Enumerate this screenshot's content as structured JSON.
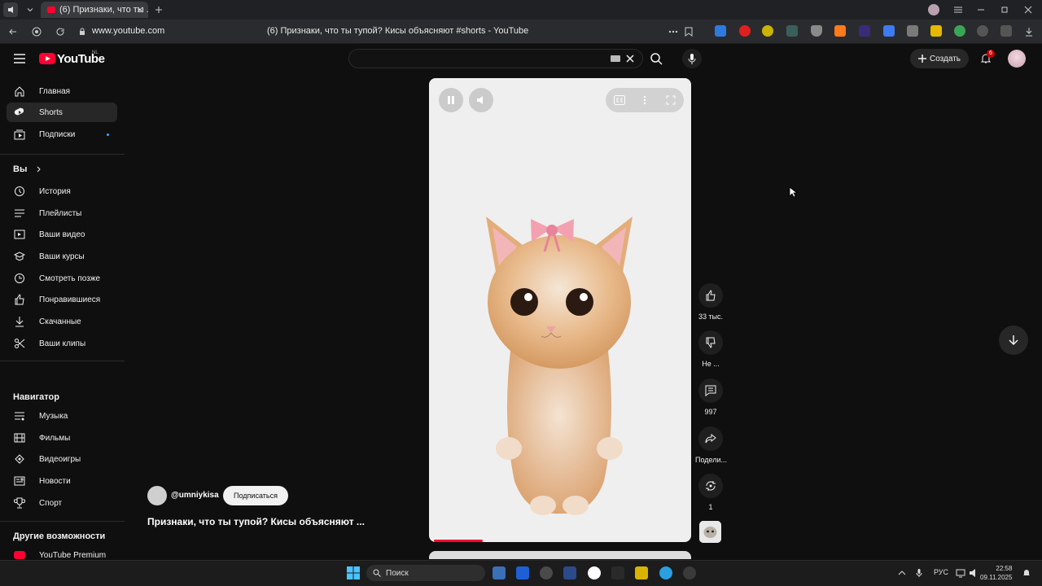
{
  "browser": {
    "tab_title": "(6) Признаки, что ты ...",
    "url": "www.youtube.com",
    "page_title": "(6) Признаки, что ты тупой? Кисы объясняют #shorts - YouTube"
  },
  "header": {
    "logo_text": "YouTube",
    "logo_country": "NL",
    "search_placeholder": "",
    "create_label": "Создать",
    "notifications_count": "6"
  },
  "sidebar": {
    "main": [
      {
        "label": "Главная",
        "icon": "home-icon"
      },
      {
        "label": "Shorts",
        "icon": "shorts-icon",
        "active": true
      },
      {
        "label": "Подписки",
        "icon": "subscriptions-icon"
      }
    ],
    "you_heading": "Вы",
    "you": [
      {
        "label": "История",
        "icon": "history-icon"
      },
      {
        "label": "Плейлисты",
        "icon": "playlists-icon"
      },
      {
        "label": "Ваши видео",
        "icon": "your-videos-icon"
      },
      {
        "label": "Ваши курсы",
        "icon": "courses-icon"
      },
      {
        "label": "Смотреть позже",
        "icon": "watch-later-icon"
      },
      {
        "label": "Понравившиеся",
        "icon": "liked-icon"
      },
      {
        "label": "Скачанные",
        "icon": "download-icon"
      },
      {
        "label": "Ваши клипы",
        "icon": "clips-icon"
      }
    ],
    "nav_heading": "Навигатор",
    "nav": [
      {
        "label": "Музыка",
        "icon": "music-icon"
      },
      {
        "label": "Фильмы",
        "icon": "movies-icon"
      },
      {
        "label": "Видеоигры",
        "icon": "gaming-icon"
      },
      {
        "label": "Новости",
        "icon": "news-icon"
      },
      {
        "label": "Спорт",
        "icon": "trophy-icon"
      }
    ],
    "more_heading": "Другие возможности",
    "more": [
      {
        "label": "YouTube Premium",
        "icon": "youtube-premium-icon"
      }
    ]
  },
  "short": {
    "channel": "@umniykisa",
    "subscribe_label": "Подписаться",
    "title": "Признаки, что ты тупой? Кисы объясняют ...",
    "progress": 0.19
  },
  "actions": {
    "like_count": "33 тыс.",
    "dislike_label": "Не ...",
    "comments_count": "997",
    "share_label": "Подели...",
    "remix_count": "1"
  },
  "taskbar": {
    "search_label": "Поиск",
    "lang": "РУС",
    "time": "22:58",
    "date": "09.11.2025"
  },
  "colors": {
    "accent": "#ff0033",
    "background": "#0f0f0f"
  }
}
